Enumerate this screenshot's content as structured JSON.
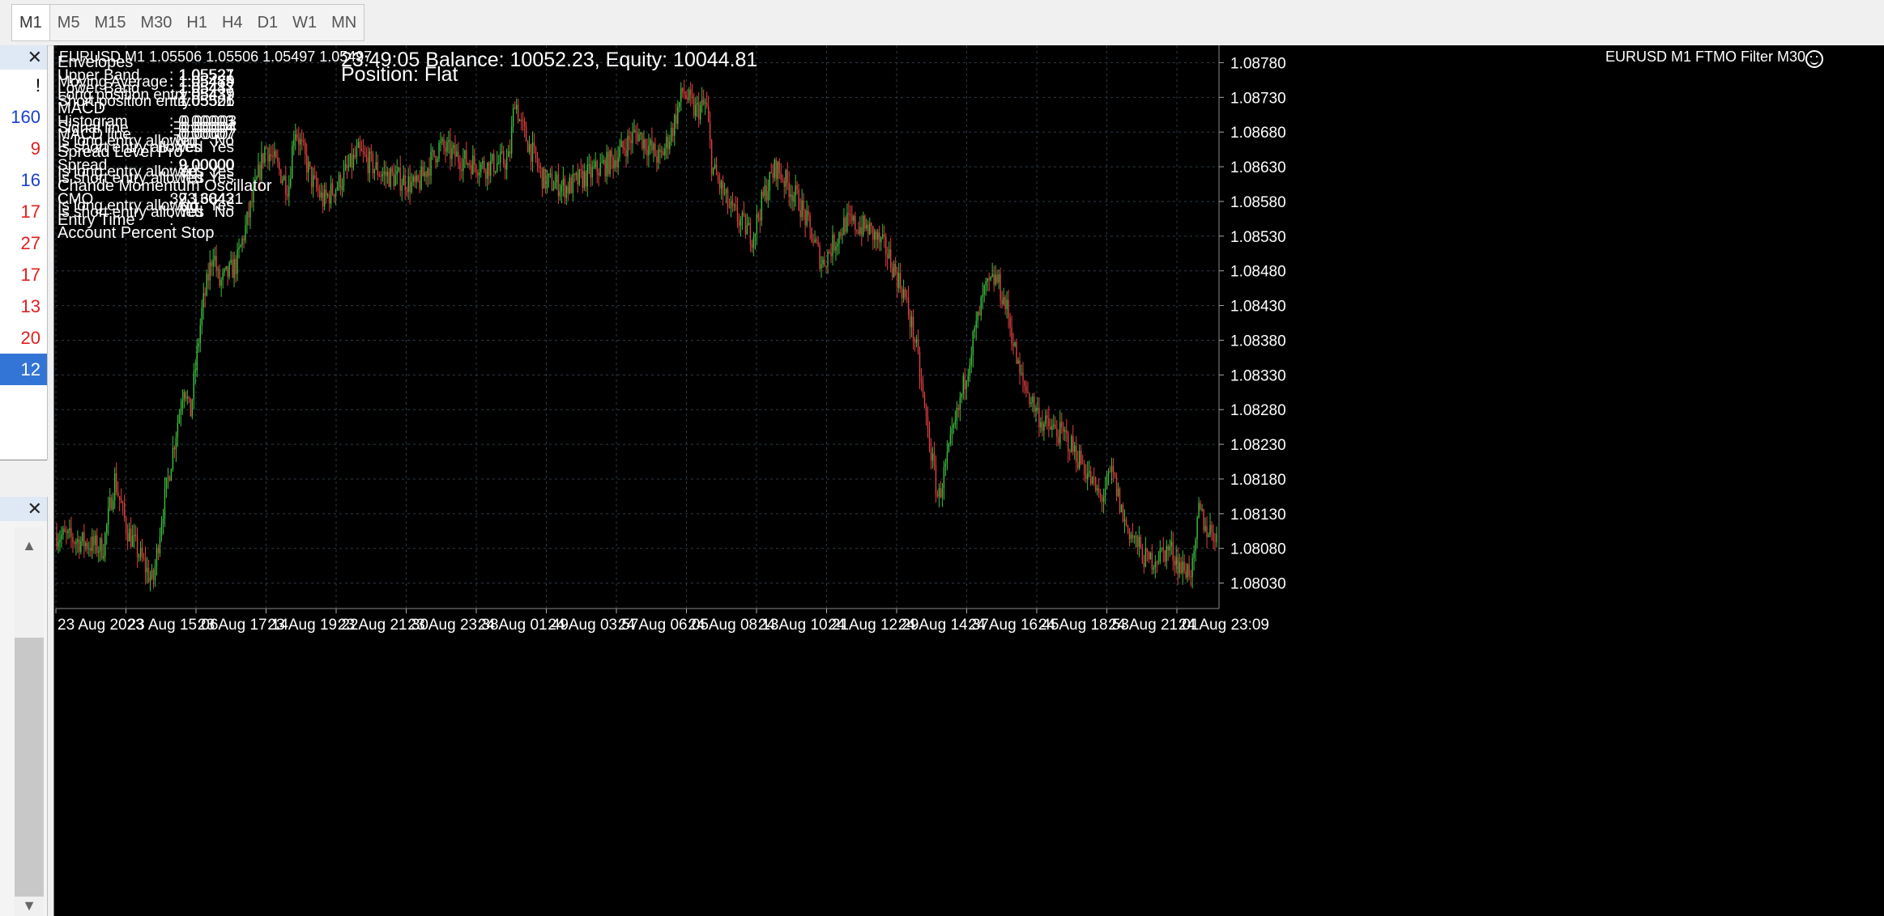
{
  "timeframes": [
    {
      "label": "M1",
      "active": true
    },
    {
      "label": "M5"
    },
    {
      "label": "M15"
    },
    {
      "label": "M30"
    },
    {
      "label": "H1"
    },
    {
      "label": "H4"
    },
    {
      "label": "D1"
    },
    {
      "label": "W1"
    },
    {
      "label": "MN"
    }
  ],
  "left_panel": {
    "close_glyph": "✕",
    "rows": [
      {
        "text": "!",
        "color": "#000000"
      },
      {
        "text": "160",
        "color": "#1a3fd0"
      },
      {
        "text": "9",
        "color": "#e02020"
      },
      {
        "text": "16",
        "color": "#1a3fd0"
      },
      {
        "text": "17",
        "color": "#e02020"
      },
      {
        "text": "27",
        "color": "#e02020"
      },
      {
        "text": "17",
        "color": "#e02020"
      },
      {
        "text": "13",
        "color": "#e02020"
      },
      {
        "text": "20",
        "color": "#e02020"
      },
      {
        "text": "12",
        "color": "#ffffff",
        "selected": true
      }
    ]
  },
  "left_panel_bottom": {
    "close_glyph": "✕",
    "up_glyph": "▲",
    "down_glyph": "▼"
  },
  "chart": {
    "header": "EURUSD,M1  1.05506 1.05506 1.05497 1.05497",
    "time_overlay": "23:49:05",
    "balance_text": "Balance: 10052.23, Equity: 10044.81",
    "position_text": "Position: Flat",
    "ea_title": "EURUSD M1 FTMO Filter M30",
    "colors": {
      "background": "#000000",
      "grid": "#2d3a46",
      "up": "#3fbf3f",
      "down": "#e04040",
      "text": "#ffffff"
    }
  },
  "indicators": [
    {
      "title": "Envelopes",
      "rows": [
        {
          "label": "Upper Band",
          "sep": ":",
          "v1": "1.05521",
          "v2": "1.05527"
        },
        {
          "label": "Moving Average",
          "sep": ":",
          "v1": "1.05479",
          "v2": "1.05485"
        },
        {
          "label": "Lower Band",
          "sep": ":",
          "v1": "1.05437",
          "v2": "1.05443"
        },
        {
          "label": "Long position entry",
          "sep": ":",
          "v1": "1.05439",
          "v2": "1.05437"
        },
        {
          "label": "Short position entry",
          "sep": ":",
          "v1": "1.05506",
          "v2": "1.05521"
        }
      ]
    },
    {
      "title": "MACD",
      "rows": [
        {
          "label": "Histogram",
          "sep": ":",
          "v1": "-0.00003",
          "v2": "-0.00003"
        },
        {
          "label": "Signal line",
          "sep": ":",
          "v1": "-0.00004",
          "v2": "-0.00004"
        },
        {
          "label": "MACD line",
          "sep": ":",
          "v1": "-0.00007",
          "v2": "-0.00007"
        },
        {
          "label": "Is long entry allowed",
          "sep": ":",
          "v1": "No",
          "v2": "No"
        },
        {
          "label": "Is short entry allowed",
          "sep": ":",
          "v1": "Yes",
          "v2": "Yes"
        }
      ]
    },
    {
      "title": "Spread Level Pro",
      "rows": [
        {
          "label": "Spread",
          "sep": ":",
          "v1": "9.00000",
          "v2": "9.00000"
        },
        {
          "label": "Is long entry allowed",
          "sep": ":",
          "v1": "Yes",
          "v2": "Yes"
        },
        {
          "label": "Is short entry allowed",
          "sep": ":",
          "v1": "Yes",
          "v2": "Yes"
        }
      ]
    },
    {
      "title": "Chande Momentum Oscillator",
      "rows": [
        {
          "label": "CMO",
          "sep": ":",
          "v1": "73.68421",
          "v2": "39.13043"
        },
        {
          "label": "Is long entry allowed",
          "sep": ":",
          "v1": "No",
          "v2": "Yes"
        },
        {
          "label": "Is short entry allowed",
          "sep": ":",
          "v1": "Yes",
          "v2": "No"
        }
      ]
    }
  ],
  "extra_rows": [
    {
      "label": "Entry Time",
      "sep": ":"
    },
    {
      "label": "Account Percent Stop",
      "sep": ""
    }
  ],
  "chart_data": {
    "type": "candlestick",
    "symbol": "EURUSD",
    "timeframe": "M1",
    "ylim": [
      1.08005,
      1.08805
    ],
    "y_ticks": [
      "1.08780",
      "1.08730",
      "1.08680",
      "1.08630",
      "1.08580",
      "1.08530",
      "1.08480",
      "1.08430",
      "1.08380",
      "1.08330",
      "1.08280",
      "1.08230",
      "1.08180",
      "1.08130",
      "1.08080",
      "1.08030"
    ],
    "x_ticks": [
      "23 Aug 2023",
      "23 Aug 15:06",
      "23 Aug 17:14",
      "23 Aug 19:22",
      "23 Aug 21:30",
      "23 Aug 23:38",
      "24 Aug 01:49",
      "24 Aug 03:57",
      "24 Aug 06:05",
      "24 Aug 08:13",
      "24 Aug 10:21",
      "24 Aug 12:29",
      "24 Aug 14:37",
      "24 Aug 16:45",
      "24 Aug 18:53",
      "24 Aug 21:01",
      "24 Aug 23:09"
    ],
    "close_path": [
      {
        "t": 0,
        "p": 1.081
      },
      {
        "t": 0.04,
        "p": 1.0808
      },
      {
        "t": 0.05,
        "p": 1.0818
      },
      {
        "t": 0.06,
        "p": 1.0811
      },
      {
        "t": 0.08,
        "p": 1.0804
      },
      {
        "t": 0.083,
        "p": 1.0803
      },
      {
        "t": 0.09,
        "p": 1.0812
      },
      {
        "t": 0.11,
        "p": 1.0832
      },
      {
        "t": 0.115,
        "p": 1.0827
      },
      {
        "t": 0.125,
        "p": 1.0842
      },
      {
        "t": 0.135,
        "p": 1.0851
      },
      {
        "t": 0.14,
        "p": 1.0846
      },
      {
        "t": 0.155,
        "p": 1.0849
      },
      {
        "t": 0.17,
        "p": 1.0859
      },
      {
        "t": 0.18,
        "p": 1.0866
      },
      {
        "t": 0.2,
        "p": 1.086
      },
      {
        "t": 0.205,
        "p": 1.0869
      },
      {
        "t": 0.22,
        "p": 1.0861
      },
      {
        "t": 0.23,
        "p": 1.0858
      },
      {
        "t": 0.245,
        "p": 1.0861
      },
      {
        "t": 0.26,
        "p": 1.0865
      },
      {
        "t": 0.28,
        "p": 1.0862
      },
      {
        "t": 0.3,
        "p": 1.0861
      },
      {
        "t": 0.31,
        "p": 1.086
      },
      {
        "t": 0.33,
        "p": 1.0866
      },
      {
        "t": 0.35,
        "p": 1.0864
      },
      {
        "t": 0.37,
        "p": 1.0863
      },
      {
        "t": 0.39,
        "p": 1.0864
      },
      {
        "t": 0.395,
        "p": 1.0873
      },
      {
        "t": 0.4,
        "p": 1.0869
      },
      {
        "t": 0.42,
        "p": 1.0861
      },
      {
        "t": 0.44,
        "p": 1.086
      },
      {
        "t": 0.46,
        "p": 1.0862
      },
      {
        "t": 0.48,
        "p": 1.0864
      },
      {
        "t": 0.5,
        "p": 1.0868
      },
      {
        "t": 0.52,
        "p": 1.0864
      },
      {
        "t": 0.53,
        "p": 1.0868
      },
      {
        "t": 0.54,
        "p": 1.0874
      },
      {
        "t": 0.55,
        "p": 1.0871
      },
      {
        "t": 0.56,
        "p": 1.0872
      },
      {
        "t": 0.565,
        "p": 1.0863
      },
      {
        "t": 0.58,
        "p": 1.0857
      },
      {
        "t": 0.6,
        "p": 1.0853
      },
      {
        "t": 0.61,
        "p": 1.0859
      },
      {
        "t": 0.62,
        "p": 1.0863
      },
      {
        "t": 0.64,
        "p": 1.0858
      },
      {
        "t": 0.66,
        "p": 1.0849
      },
      {
        "t": 0.67,
        "p": 1.0852
      },
      {
        "t": 0.68,
        "p": 1.0855
      },
      {
        "t": 0.7,
        "p": 1.0854
      },
      {
        "t": 0.715,
        "p": 1.0851
      },
      {
        "t": 0.73,
        "p": 1.0845
      },
      {
        "t": 0.74,
        "p": 1.0838
      },
      {
        "t": 0.75,
        "p": 1.0826
      },
      {
        "t": 0.76,
        "p": 1.0815
      },
      {
        "t": 0.775,
        "p": 1.0826
      },
      {
        "t": 0.79,
        "p": 1.0838
      },
      {
        "t": 0.8,
        "p": 1.0845
      },
      {
        "t": 0.81,
        "p": 1.0847
      },
      {
        "t": 0.82,
        "p": 1.0842
      },
      {
        "t": 0.83,
        "p": 1.0833
      },
      {
        "t": 0.85,
        "p": 1.0826
      },
      {
        "t": 0.87,
        "p": 1.0824
      },
      {
        "t": 0.885,
        "p": 1.082
      },
      {
        "t": 0.9,
        "p": 1.0815
      },
      {
        "t": 0.91,
        "p": 1.0819
      },
      {
        "t": 0.92,
        "p": 1.0812
      },
      {
        "t": 0.94,
        "p": 1.0806
      },
      {
        "t": 0.96,
        "p": 1.0808
      },
      {
        "t": 0.97,
        "p": 1.0805
      },
      {
        "t": 0.98,
        "p": 1.0805
      },
      {
        "t": 0.985,
        "p": 1.0814
      },
      {
        "t": 0.99,
        "p": 1.0811
      },
      {
        "t": 1.0,
        "p": 1.081
      }
    ]
  }
}
